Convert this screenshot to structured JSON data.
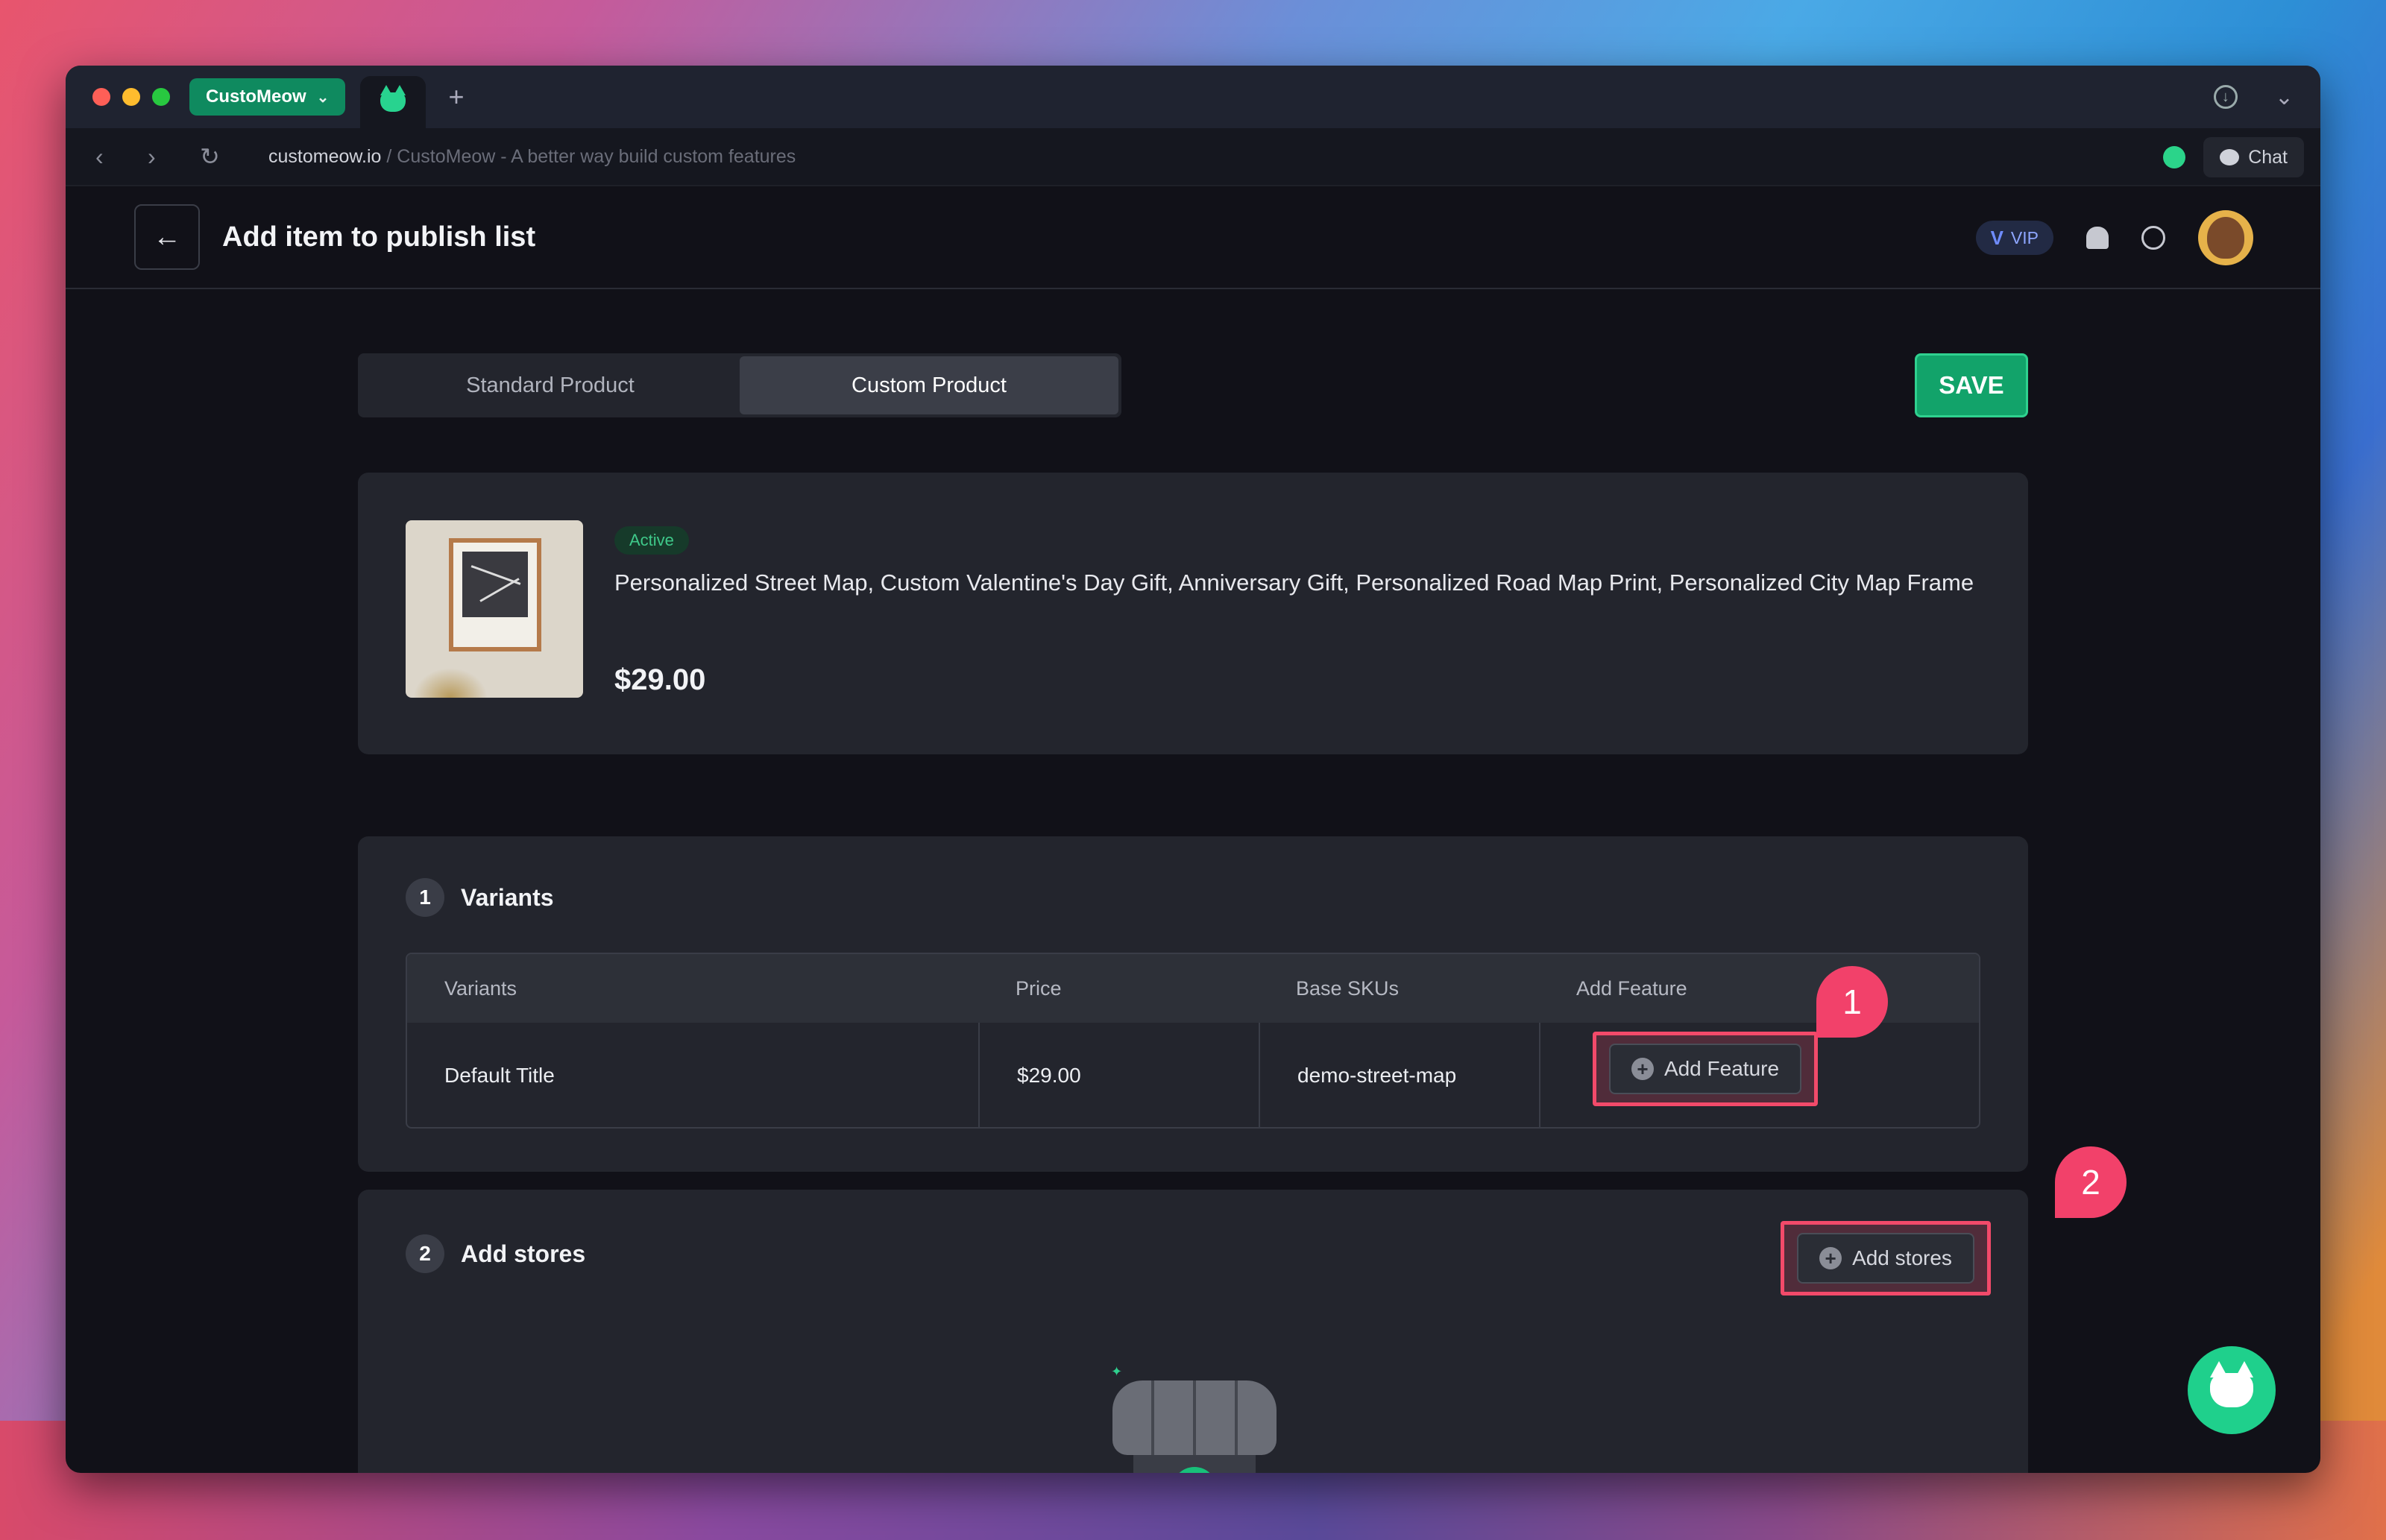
{
  "browser": {
    "app_tab_label": "CustoMeow",
    "url_domain": "customeow.io",
    "url_rest": " / CustoMeow - A better way build custom features",
    "chat_label": "Chat"
  },
  "header": {
    "title": "Add item to publish list",
    "vip_label": "VIP"
  },
  "tabs": [
    {
      "label": "Standard Product",
      "active": false
    },
    {
      "label": "Custom Product",
      "active": true
    }
  ],
  "save_label": "SAVE",
  "product": {
    "status": "Active",
    "title": "Personalized Street Map, Custom Valentine's Day Gift, Anniversary Gift, Personalized Road Map Print, Personalized City Map Frame",
    "price": "$29.00"
  },
  "variants_section": {
    "step": "1",
    "title": "Variants",
    "columns": [
      "Variants",
      "Price",
      "Base SKUs",
      "Add Feature"
    ],
    "rows": [
      {
        "variant": "Default Title",
        "price": "$29.00",
        "sku": "demo-street-map",
        "action_label": "Add Feature"
      }
    ]
  },
  "stores_section": {
    "step": "2",
    "title": "Add stores",
    "action_label": "Add stores"
  },
  "callouts": [
    "1",
    "2"
  ],
  "colors": {
    "accent_green": "#12a36a",
    "highlight_red": "#f24a6a",
    "background": "#111118"
  }
}
